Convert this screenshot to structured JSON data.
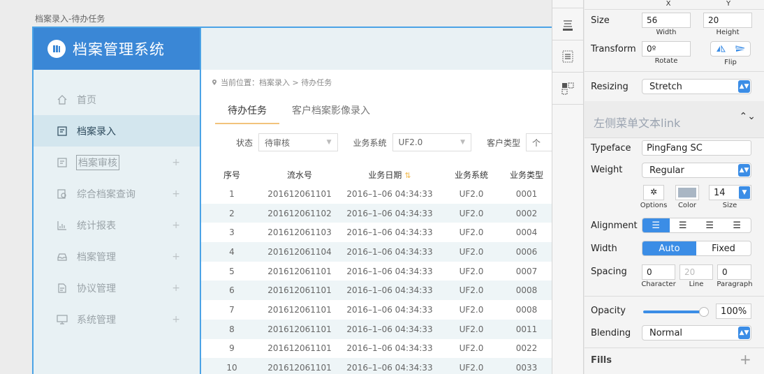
{
  "artboard": {
    "title": "档案录入-待办任务"
  },
  "app": {
    "brand_title": "档案管理系统",
    "menu": [
      {
        "label": "首页",
        "icon": "home-icon",
        "active": false,
        "plus": ""
      },
      {
        "label": "档案录入",
        "icon": "edit-icon",
        "active": true,
        "plus": ""
      },
      {
        "label": "档案审核",
        "icon": "review-icon",
        "active": false,
        "plus": "+"
      },
      {
        "label": "综合档案查询",
        "icon": "search-doc-icon",
        "active": false,
        "plus": "+"
      },
      {
        "label": "统计报表",
        "icon": "chart-icon",
        "active": false,
        "plus": "+"
      },
      {
        "label": "档案管理",
        "icon": "archive-icon",
        "active": false,
        "plus": "+"
      },
      {
        "label": "协议管理",
        "icon": "contract-icon",
        "active": false,
        "plus": "+"
      },
      {
        "label": "系统管理",
        "icon": "monitor-icon",
        "active": false,
        "plus": "+"
      }
    ],
    "breadcrumb": "当前位置：档案录入 > 待办任务",
    "tabs": [
      {
        "label": "待办任务",
        "active": true
      },
      {
        "label": "客户档案影像录入",
        "active": false
      }
    ],
    "filters": {
      "status_label": "状态",
      "status_value": "待审核",
      "system_label": "业务系统",
      "system_value": "UF2.0",
      "customer_type_label": "客户类型",
      "customer_type_value": "个"
    },
    "table": {
      "headers": [
        "序号",
        "流水号",
        "业务日期",
        "业务系统",
        "业务类型"
      ],
      "sort_icon": "⇅",
      "rows": [
        [
          "1",
          "201612061101",
          "2016–1–06 04:34:33",
          "UF2.0",
          "0001"
        ],
        [
          "2",
          "201612061102",
          "2016–1–06 04:34:33",
          "UF2.0",
          "0002"
        ],
        [
          "3",
          "201612061103",
          "2016–1–06 04:34:33",
          "UF2.0",
          "0004"
        ],
        [
          "4",
          "201612061104",
          "2016–1–06 04:34:33",
          "UF2.0",
          "0006"
        ],
        [
          "5",
          "201612061101",
          "2016–1–06 04:34:33",
          "UF2.0",
          "0007"
        ],
        [
          "6",
          "201612061101",
          "2016–1–06 04:34:33",
          "UF2.0",
          "0008"
        ],
        [
          "7",
          "201612061101",
          "2016–1–06 04:34:33",
          "UF2.0",
          "0008"
        ],
        [
          "8",
          "201612061101",
          "2016–1–06 04:34:33",
          "UF2.0",
          "0011"
        ],
        [
          "9",
          "201612061101",
          "2016–1–06 04:34:33",
          "UF2.0",
          "0022"
        ],
        [
          "10",
          "201612061101",
          "2016–1–06 04:34:33",
          "UF2.0",
          "0033"
        ]
      ]
    }
  },
  "inspector": {
    "x_label": "X",
    "y_label": "Y",
    "size_label": "Size",
    "width_value": "56",
    "height_value": "20",
    "width_label": "Width",
    "height_label": "Height",
    "transform_label": "Transform",
    "rotate_value": "0º",
    "rotate_label": "Rotate",
    "flip_label": "Flip",
    "resizing_label": "Resizing",
    "resizing_value": "Stretch",
    "text_style_name": "左侧菜单文本link",
    "typeface_label": "Typeface",
    "typeface_value": "PingFang SC",
    "weight_label": "Weight",
    "weight_value": "Regular",
    "font_size_value": "14",
    "options_label": "Options",
    "color_label": "Color",
    "size_small_label": "Size",
    "alignment_label": "Alignment",
    "width_mode_label": "Width",
    "width_auto": "Auto",
    "width_fixed": "Fixed",
    "spacing_label": "Spacing",
    "character_value": "0",
    "line_value": "20",
    "paragraph_value": "0",
    "character_label": "Character",
    "line_label": "Line",
    "paragraph_label": "Paragraph",
    "opacity_label": "Opacity",
    "opacity_value": "100%",
    "opacity_fraction": 1.0,
    "blending_label": "Blending",
    "blending_value": "Normal",
    "fills_label": "Fills",
    "fills_add": "+",
    "colors": {
      "accent": "#3b8de6",
      "text_color_swatch": "#a9b6c4"
    }
  }
}
